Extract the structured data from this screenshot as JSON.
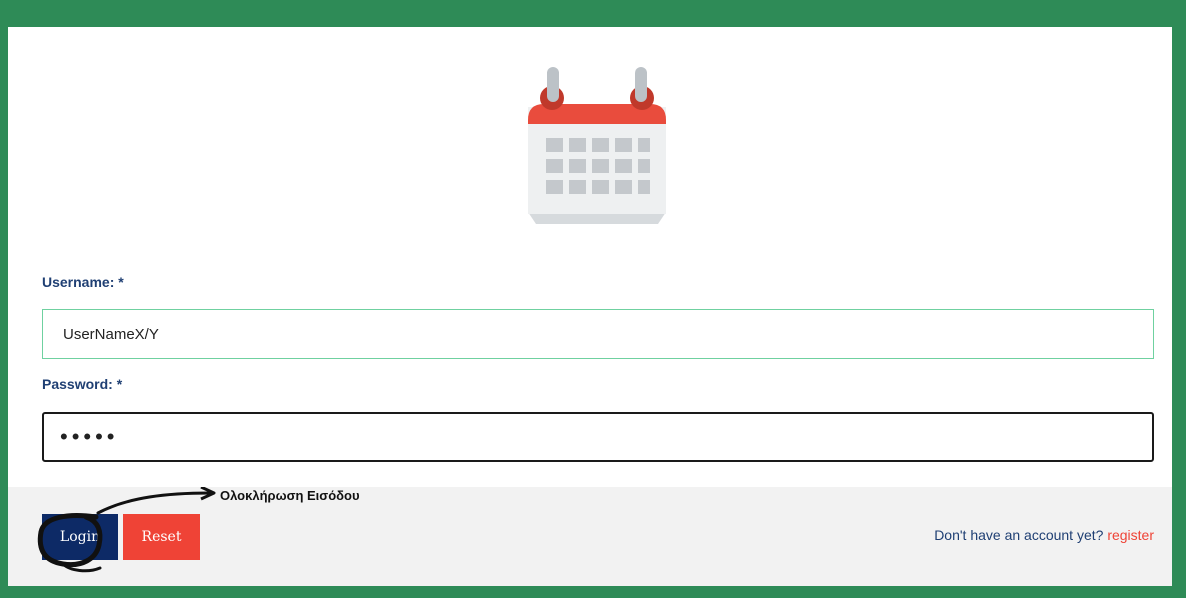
{
  "form": {
    "username_label": "Username: *",
    "username_value": "UserNameX/Y",
    "password_label": "Password: *",
    "password_value": "•••••"
  },
  "actions": {
    "login_label": "Login",
    "reset_label": "Reset"
  },
  "annotation": {
    "text": "Ολοκλήρωση Εισόδου"
  },
  "register": {
    "prompt": "Don't have an account yet?",
    "link_label": "register"
  },
  "colors": {
    "frame_border": "#2e8b57",
    "label_text": "#1f3f73",
    "login_button": "#0d2a66",
    "reset_button": "#ef4336",
    "register_link": "#ef4336",
    "calendar_header": "#e94c3d"
  },
  "icons": [
    "calendar-icon"
  ]
}
